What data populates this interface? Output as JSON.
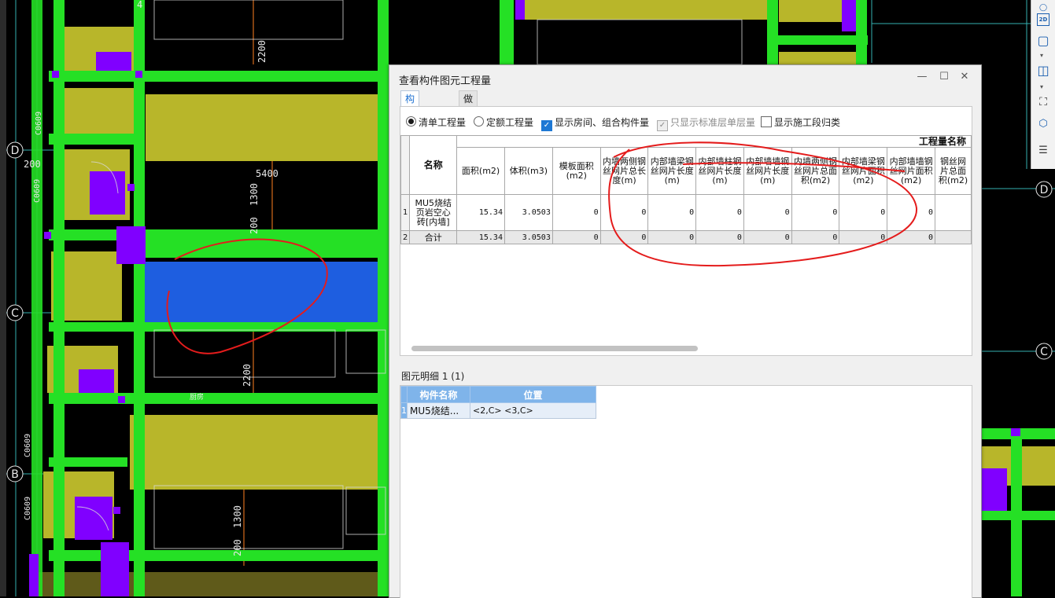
{
  "dialog": {
    "title": "查看构件图元工程量",
    "tabs": [
      {
        "label": "构件工程量",
        "active": true
      },
      {
        "label": "做法工程量",
        "active": false
      }
    ],
    "options": {
      "qingdan": "清单工程量",
      "dinge": "定额工程量",
      "show_room": "显示房间、组合构件量",
      "only_standard": "只显示标准层单层量",
      "show_section": "显示施工段归类"
    },
    "option_states": {
      "qingdan": true,
      "dinge": false,
      "show_room": true,
      "only_standard": true,
      "show_section": false
    },
    "table": {
      "group_title": "工程量名称",
      "name_header": "名称",
      "columns": [
        "面积(m2)",
        "体积(m3)",
        "模板面积(m2)",
        "内墙两侧钢丝网片总长度(m)",
        "内部墙梁钢丝网片长度(m)",
        "内部墙柱钢丝网片长度(m)",
        "内部墙墙钢丝网片长度(m)",
        "内墙两侧钢丝网片总面积(m2)",
        "内部墙梁钢丝网片面积(m2)",
        "内部墙墙钢丝网片面积(m2)",
        "钢丝网片总面积(m2)"
      ],
      "rows": [
        {
          "num": "1",
          "name": "MU5烧结页岩空心砖[内墙]",
          "values": [
            "15.34",
            "3.0503",
            "0",
            "0",
            "0",
            "0",
            "0",
            "0",
            "0",
            "0",
            ""
          ]
        },
        {
          "num": "2",
          "name": "合计",
          "values": [
            "15.34",
            "3.0503",
            "0",
            "0",
            "0",
            "0",
            "0",
            "0",
            "0",
            "0",
            ""
          ]
        }
      ]
    },
    "detail": {
      "label": "图元明细  1 (1)",
      "headers": [
        "构件名称",
        "位置"
      ],
      "rows": [
        {
          "num": "1",
          "name": "MU5烧结...",
          "position": "<2,C> <3,C>"
        }
      ]
    }
  },
  "toolbar": {
    "view_2d": "2D"
  },
  "drawing": {
    "axis_labels": [
      "D",
      "C",
      "B",
      "D",
      "C"
    ],
    "dimensions": [
      "2200",
      "5400",
      "1300",
      "200",
      "2200",
      "1300",
      "200",
      "200",
      "C0609",
      "C0609",
      "C0609",
      "C0609",
      "4",
      "厨房"
    ]
  },
  "colors": {
    "beam_green": "#25e025",
    "wall_olive": "#b8b62a",
    "column_purple": "#8000ff",
    "selected_blue": "#1e5ee0",
    "annotation_red": "#e41c1c"
  }
}
